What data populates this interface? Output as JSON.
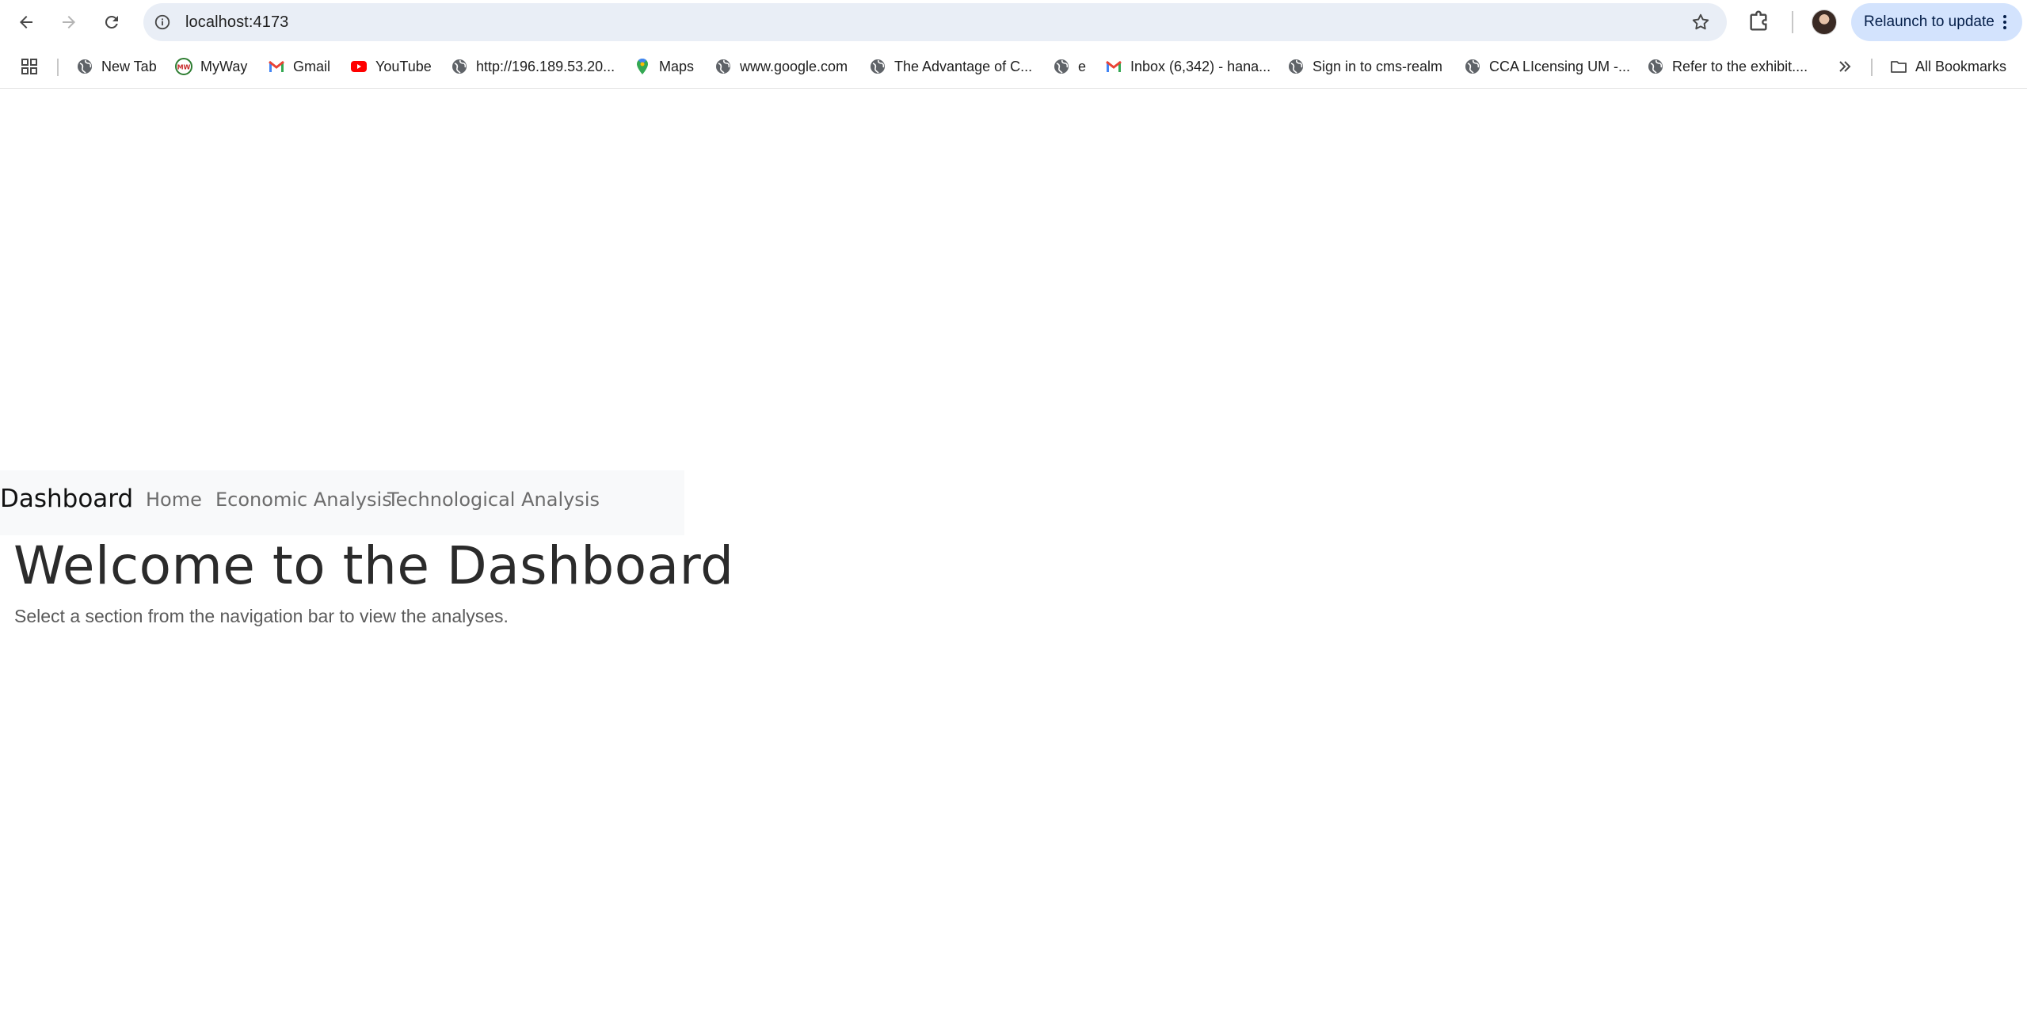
{
  "browser": {
    "url": "localhost:4173",
    "relaunch_label": "Relaunch to update",
    "bookmarks": [
      {
        "label": "New Tab",
        "icon": "globe-icon"
      },
      {
        "label": "MyWay",
        "icon": "myway-icon"
      },
      {
        "label": "Gmail",
        "icon": "gmail-icon"
      },
      {
        "label": "YouTube",
        "icon": "youtube-icon"
      },
      {
        "label": "http://196.189.53.20...",
        "icon": "globe-icon"
      },
      {
        "label": "Maps",
        "icon": "maps-icon"
      },
      {
        "label": "www.google.com",
        "icon": "globe-icon"
      },
      {
        "label": "The Advantage of C...",
        "icon": "globe-icon"
      },
      {
        "label": "e",
        "icon": "globe-icon"
      },
      {
        "label": "Inbox (6,342) - hana...",
        "icon": "gmail-icon"
      },
      {
        "label": "Sign in to cms-realm",
        "icon": "globe-icon"
      },
      {
        "label": "CCA LIcensing UM -...",
        "icon": "globe-icon"
      },
      {
        "label": "Refer to the exhibit....",
        "icon": "globe-icon"
      }
    ],
    "all_bookmarks_label": "All Bookmarks"
  },
  "page": {
    "navbar": {
      "brand": "Dashboard",
      "links": [
        "Home",
        "Economic Analysis",
        "Technological Analysis"
      ]
    },
    "title": "Welcome to the Dashboard",
    "subtitle": "Select a section from the navigation bar to view the analyses."
  }
}
